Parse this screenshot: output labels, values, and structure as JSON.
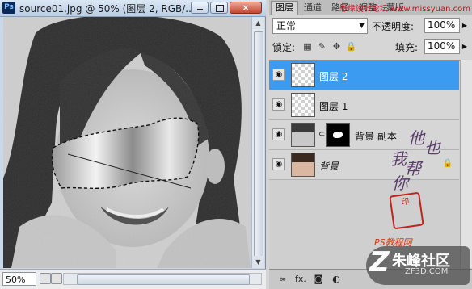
{
  "document": {
    "title": "source01.jpg @ 50% (图层 2, RGB/...",
    "app_icon": "Ps",
    "zoom": "50%",
    "buttons": {
      "minimize": "minimize-icon",
      "maximize": "maximize-icon",
      "close": "×"
    }
  },
  "layers_panel": {
    "tabs": [
      {
        "label": "图层",
        "active": true
      },
      {
        "label": "通道",
        "active": false
      },
      {
        "label": "路径",
        "active": false
      },
      {
        "label": "调整",
        "active": false
      },
      {
        "label": "蒙版",
        "active": false
      }
    ],
    "watermark_top": "思缘设计论坛 www.missyuan.com",
    "blend_mode": "正常",
    "opacity_label": "不透明度:",
    "opacity_value": "100%",
    "lock_label": "锁定:",
    "fill_label": "填充:",
    "fill_value": "100%",
    "layers": [
      {
        "name": "图层 2",
        "selected": true,
        "thumbnail": "transparent"
      },
      {
        "name": "图层 1",
        "selected": false,
        "thumbnail": "transparent"
      },
      {
        "name": "背景 副本",
        "selected": false,
        "thumbnail": "photo",
        "has_mask": true
      },
      {
        "name": "背景",
        "selected": false,
        "thumbnail": "photo",
        "locked": true
      }
    ],
    "bottom_icons": [
      "link-icon",
      "fx-icon",
      "mask-icon",
      "adjustment-icon",
      "folder-icon",
      "new-layer-icon",
      "trash-icon"
    ],
    "bottom_labels": {
      "fx": "fx."
    }
  },
  "overlays": {
    "signature_lines": [
      "他",
      "也",
      "我",
      "帮",
      "你"
    ],
    "stamp_text": "印",
    "ps_watermark": "PS教程网",
    "logo_text": "朱峰社区",
    "logo_url": "ZF3D.COM"
  },
  "colors": {
    "selection": "#3b9bf0",
    "titlebar": "#c9d8ea",
    "stamp": "#c0241c"
  }
}
